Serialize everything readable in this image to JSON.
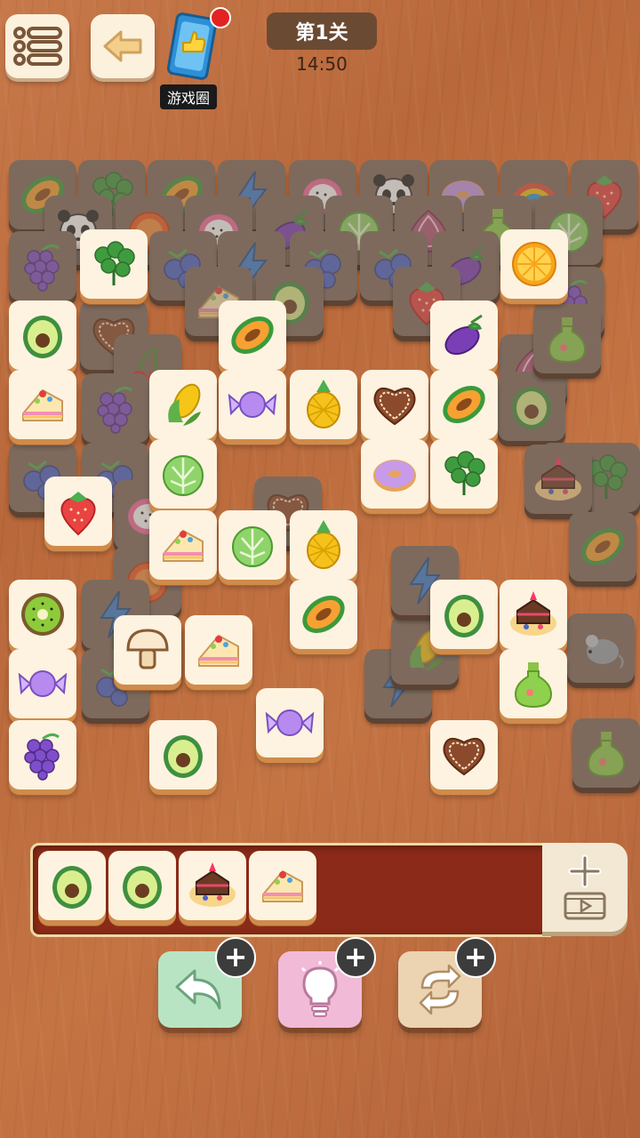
{
  "header": {
    "level_label": "第1关",
    "timer": "14:50",
    "promo_label": "游戏圈"
  },
  "board": {
    "tiles": [
      {
        "icon": "papaya",
        "state": "dim"
      },
      {
        "icon": "parsley",
        "state": "dim"
      },
      {
        "icon": "papaya",
        "state": "dim"
      },
      {
        "icon": "lightning",
        "state": "dim"
      },
      {
        "icon": "dragonfruit",
        "state": "dim"
      },
      {
        "icon": "panda",
        "state": "dim"
      },
      {
        "icon": "donut",
        "state": "dim"
      },
      {
        "icon": "rainbow",
        "state": "dim"
      },
      {
        "icon": "strawberry",
        "state": "dim"
      },
      {
        "icon": "panda",
        "state": "dim"
      },
      {
        "icon": "tomato",
        "state": "dim"
      },
      {
        "icon": "dragonfruit",
        "state": "dim"
      },
      {
        "icon": "eggplant",
        "state": "dim"
      },
      {
        "icon": "lettuce",
        "state": "dim"
      },
      {
        "icon": "onion",
        "state": "dim"
      },
      {
        "icon": "potion",
        "state": "dim"
      },
      {
        "icon": "lettuce",
        "state": "dim"
      },
      {
        "icon": "grapes",
        "state": "dim"
      },
      {
        "icon": "blueberry",
        "state": "dim"
      },
      {
        "icon": "lightning",
        "state": "dim"
      },
      {
        "icon": "blueberry",
        "state": "dim"
      },
      {
        "icon": "blueberry",
        "state": "dim"
      },
      {
        "icon": "eggplant",
        "state": "dim"
      },
      {
        "icon": "cake",
        "state": "dim"
      },
      {
        "icon": "avocado",
        "state": "dim"
      },
      {
        "icon": "strawberry",
        "state": "dim"
      },
      {
        "icon": "heart-cookie",
        "state": "dim"
      },
      {
        "icon": "cherry",
        "state": "dim"
      },
      {
        "icon": "grapes",
        "state": "dim"
      },
      {
        "icon": "blueberry",
        "state": "dim"
      },
      {
        "icon": "blueberry",
        "state": "dim"
      },
      {
        "icon": "dragonfruit",
        "state": "dim"
      },
      {
        "icon": "heart-cookie",
        "state": "dim"
      },
      {
        "icon": "tomato",
        "state": "dim"
      },
      {
        "icon": "lightning",
        "state": "dim"
      },
      {
        "icon": "mushroom",
        "state": "dim"
      },
      {
        "icon": "blueberry",
        "state": "dim"
      },
      {
        "icon": "lightning",
        "state": "dim"
      },
      {
        "icon": "corn",
        "state": "dim"
      },
      {
        "icon": "lightning",
        "state": "dim"
      },
      {
        "icon": "onion",
        "state": "dim"
      },
      {
        "icon": "avocado",
        "state": "dim"
      },
      {
        "icon": "grapes",
        "state": "dim"
      },
      {
        "icon": "blueberry",
        "state": "dim"
      },
      {
        "icon": "potion",
        "state": "dim"
      },
      {
        "icon": "parsley",
        "state": "dim"
      },
      {
        "icon": "cake-plate",
        "state": "dim"
      },
      {
        "icon": "mouse",
        "state": "dim"
      },
      {
        "icon": "papaya",
        "state": "dim"
      },
      {
        "icon": "potion",
        "state": "dim"
      },
      {
        "icon": "parsley",
        "state": "open"
      },
      {
        "icon": "orange-slice",
        "state": "open"
      },
      {
        "icon": "papaya",
        "state": "open"
      },
      {
        "icon": "eggplant",
        "state": "open"
      },
      {
        "icon": "avocado",
        "state": "open"
      },
      {
        "icon": "cake",
        "state": "open"
      },
      {
        "icon": "corn",
        "state": "open"
      },
      {
        "icon": "candy",
        "state": "open"
      },
      {
        "icon": "pineapple",
        "state": "open"
      },
      {
        "icon": "heart-cookie",
        "state": "open"
      },
      {
        "icon": "papaya",
        "state": "open"
      },
      {
        "icon": "lettuce",
        "state": "open"
      },
      {
        "icon": "donut",
        "state": "open"
      },
      {
        "icon": "parsley",
        "state": "open"
      },
      {
        "icon": "strawberry",
        "state": "open"
      },
      {
        "icon": "cake",
        "state": "open"
      },
      {
        "icon": "lettuce",
        "state": "open"
      },
      {
        "icon": "pineapple",
        "state": "open"
      },
      {
        "icon": "kiwi",
        "state": "open"
      },
      {
        "icon": "papaya",
        "state": "open"
      },
      {
        "icon": "avocado",
        "state": "open"
      },
      {
        "icon": "cake-plate",
        "state": "open"
      },
      {
        "icon": "mushroom",
        "state": "open"
      },
      {
        "icon": "cake",
        "state": "open"
      },
      {
        "icon": "candy",
        "state": "open"
      },
      {
        "icon": "potion",
        "state": "open"
      },
      {
        "icon": "candy",
        "state": "open"
      },
      {
        "icon": "grapes",
        "state": "open"
      },
      {
        "icon": "avocado",
        "state": "open"
      },
      {
        "icon": "heart-cookie",
        "state": "open"
      }
    ]
  },
  "tray": {
    "tiles": [
      {
        "icon": "avocado"
      },
      {
        "icon": "avocado"
      },
      {
        "icon": "cake-plate"
      },
      {
        "icon": "cake"
      }
    ]
  },
  "tools": [
    {
      "name": "undo",
      "badge": "+"
    },
    {
      "name": "hint",
      "badge": "+"
    },
    {
      "name": "shuffle",
      "badge": "+"
    }
  ],
  "colors": {
    "undo_bg": "#b9e4c4",
    "hint_bg": "#f1bad7",
    "shuffle_bg": "#ecd3b1"
  }
}
